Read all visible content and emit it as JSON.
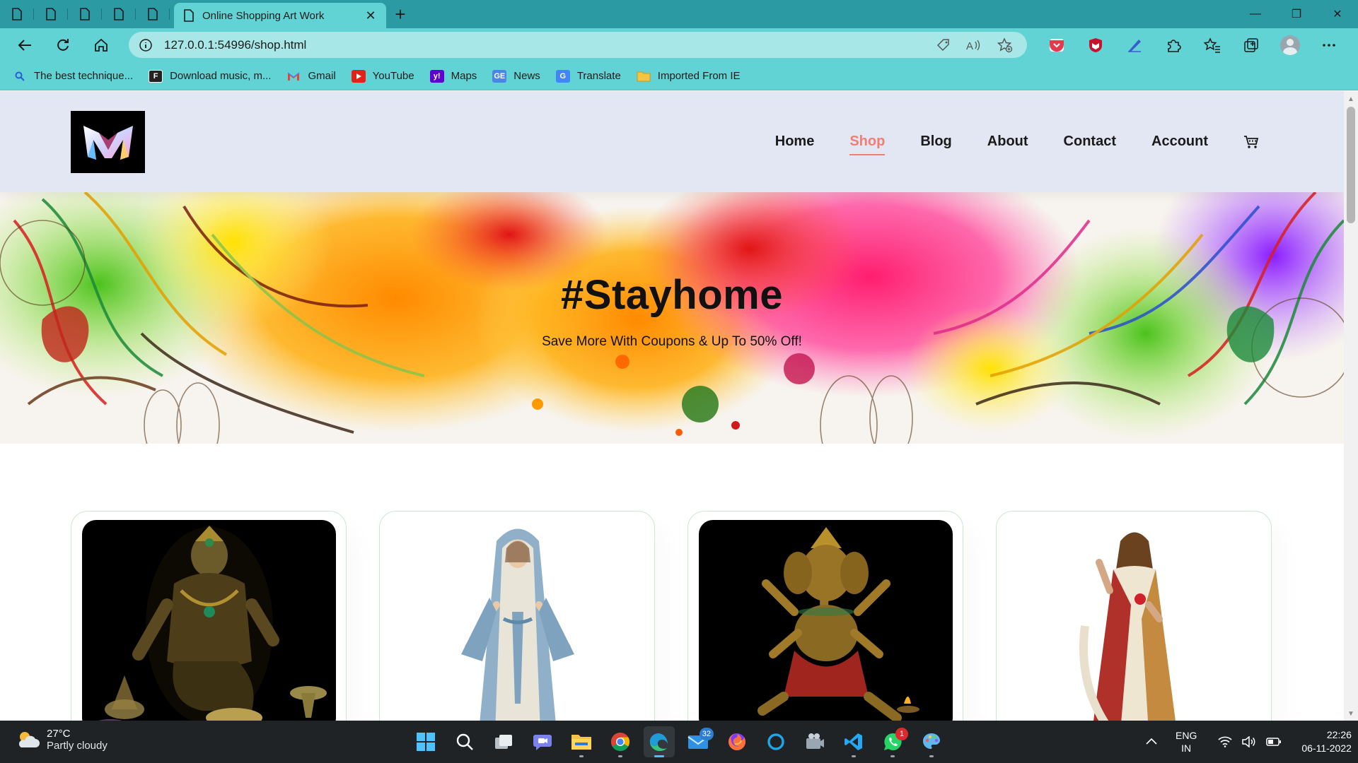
{
  "browser": {
    "tab_title": "Online Shopping Art Work",
    "url": "127.0.0.1:54996/shop.html",
    "favorites": [
      {
        "label": "The best technique...",
        "icon": "search-icon"
      },
      {
        "label": "Download music, m...",
        "icon": "f-logo-icon"
      },
      {
        "label": "Gmail",
        "icon": "gmail-icon"
      },
      {
        "label": "YouTube",
        "icon": "youtube-icon"
      },
      {
        "label": "Maps",
        "icon": "yahoo-icon"
      },
      {
        "label": "News",
        "icon": "news-icon"
      },
      {
        "label": "Translate",
        "icon": "translate-icon"
      },
      {
        "label": "Imported From IE",
        "icon": "folder-icon"
      }
    ]
  },
  "site": {
    "nav": [
      "Home",
      "Shop",
      "Blog",
      "About",
      "Contact",
      "Account"
    ],
    "active_nav": "Shop",
    "accent": "#ef7f73",
    "header_bg": "#e3e6f3"
  },
  "hero": {
    "title": "#Stayhome",
    "subtitle": "Save More With Coupons & Up To 50% Off!"
  },
  "products": [
    {
      "image": "hanuman-statue"
    },
    {
      "image": "mary-statue"
    },
    {
      "image": "ganesha-statue"
    },
    {
      "image": "jesus-statue"
    }
  ],
  "taskbar": {
    "weather_temp": "27°C",
    "weather_cond": "Partly cloudy",
    "mail_badge": "32",
    "whatsapp_badge": "1",
    "lang_top": "ENG",
    "lang_bottom": "IN",
    "time": "22:26",
    "date": "06-11-2022"
  }
}
